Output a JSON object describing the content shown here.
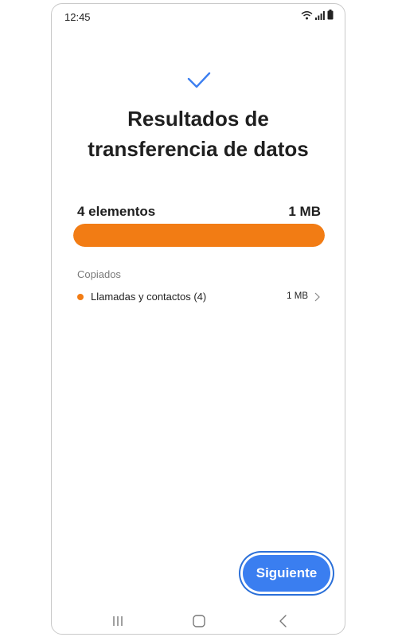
{
  "status_bar": {
    "time": "12:45"
  },
  "title_line1": "Resultados de",
  "title_line2": "transferencia de datos",
  "summary": {
    "count": "4 elementos",
    "size": "1 MB"
  },
  "progress": {
    "fraction": 1.0,
    "color": "#f27c14"
  },
  "section": {
    "label": "Copiados"
  },
  "items": [
    {
      "label": "Llamadas y contactos (4)",
      "size": "1 MB",
      "dot_color": "#f27c14"
    }
  ],
  "next_button": {
    "label": "Siguiente",
    "color": "#3a7ef0"
  },
  "nav_icons": [
    "recents-icon",
    "home-icon",
    "back-icon"
  ]
}
